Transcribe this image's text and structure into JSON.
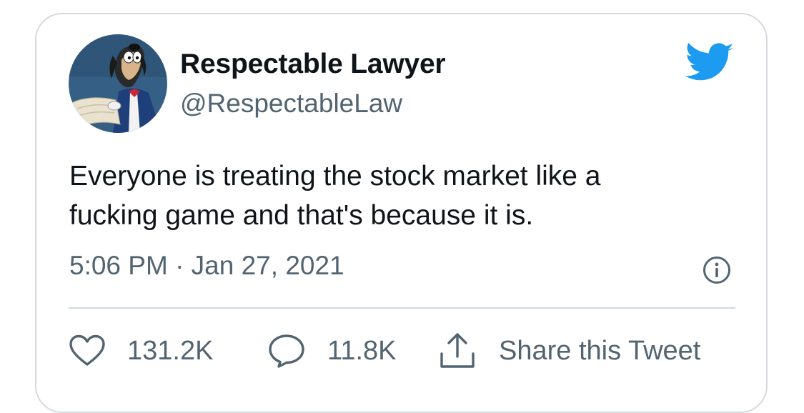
{
  "tweet": {
    "author": {
      "display_name": "Respectable Lawyer",
      "handle": "@RespectableLaw",
      "avatar_icon": "cartoon-dog-avatar"
    },
    "text_lines": [
      "Everyone is treating the stock market like a",
      "fucking game and that's because it is."
    ],
    "timestamp": "5:06 PM · Jan 27, 2021",
    "actions": {
      "like_icon": "heart-icon",
      "like_count": "131.2K",
      "reply_icon": "speech-bubble-icon",
      "reply_count": "11.8K",
      "share_icon": "share-icon",
      "share_label": "Share this Tweet"
    },
    "brand_icon": "twitter-bird-icon",
    "info_icon": "info-icon"
  },
  "colors": {
    "brand_blue": "#1d9bf0",
    "text_primary": "#0f1419",
    "text_secondary": "#536471",
    "border": "#d6dadf"
  }
}
